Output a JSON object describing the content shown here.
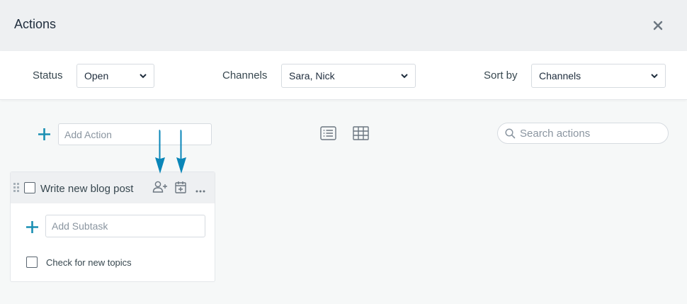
{
  "header": {
    "title": "Actions"
  },
  "filters": {
    "status": {
      "label": "Status",
      "value": "Open"
    },
    "channels": {
      "label": "Channels",
      "value": "Sara, Nick"
    },
    "sort": {
      "label": "Sort by",
      "value": "Channels"
    }
  },
  "toolbar": {
    "add_action_placeholder": "Add Action",
    "search_placeholder": "Search actions"
  },
  "task": {
    "title": "Write new blog post",
    "add_subtask_placeholder": "Add Subtask",
    "subtasks": [
      {
        "label": "Check for new topics"
      }
    ]
  },
  "colors": {
    "accent": "#1a8fb3",
    "arrow": "#0a86b8"
  }
}
